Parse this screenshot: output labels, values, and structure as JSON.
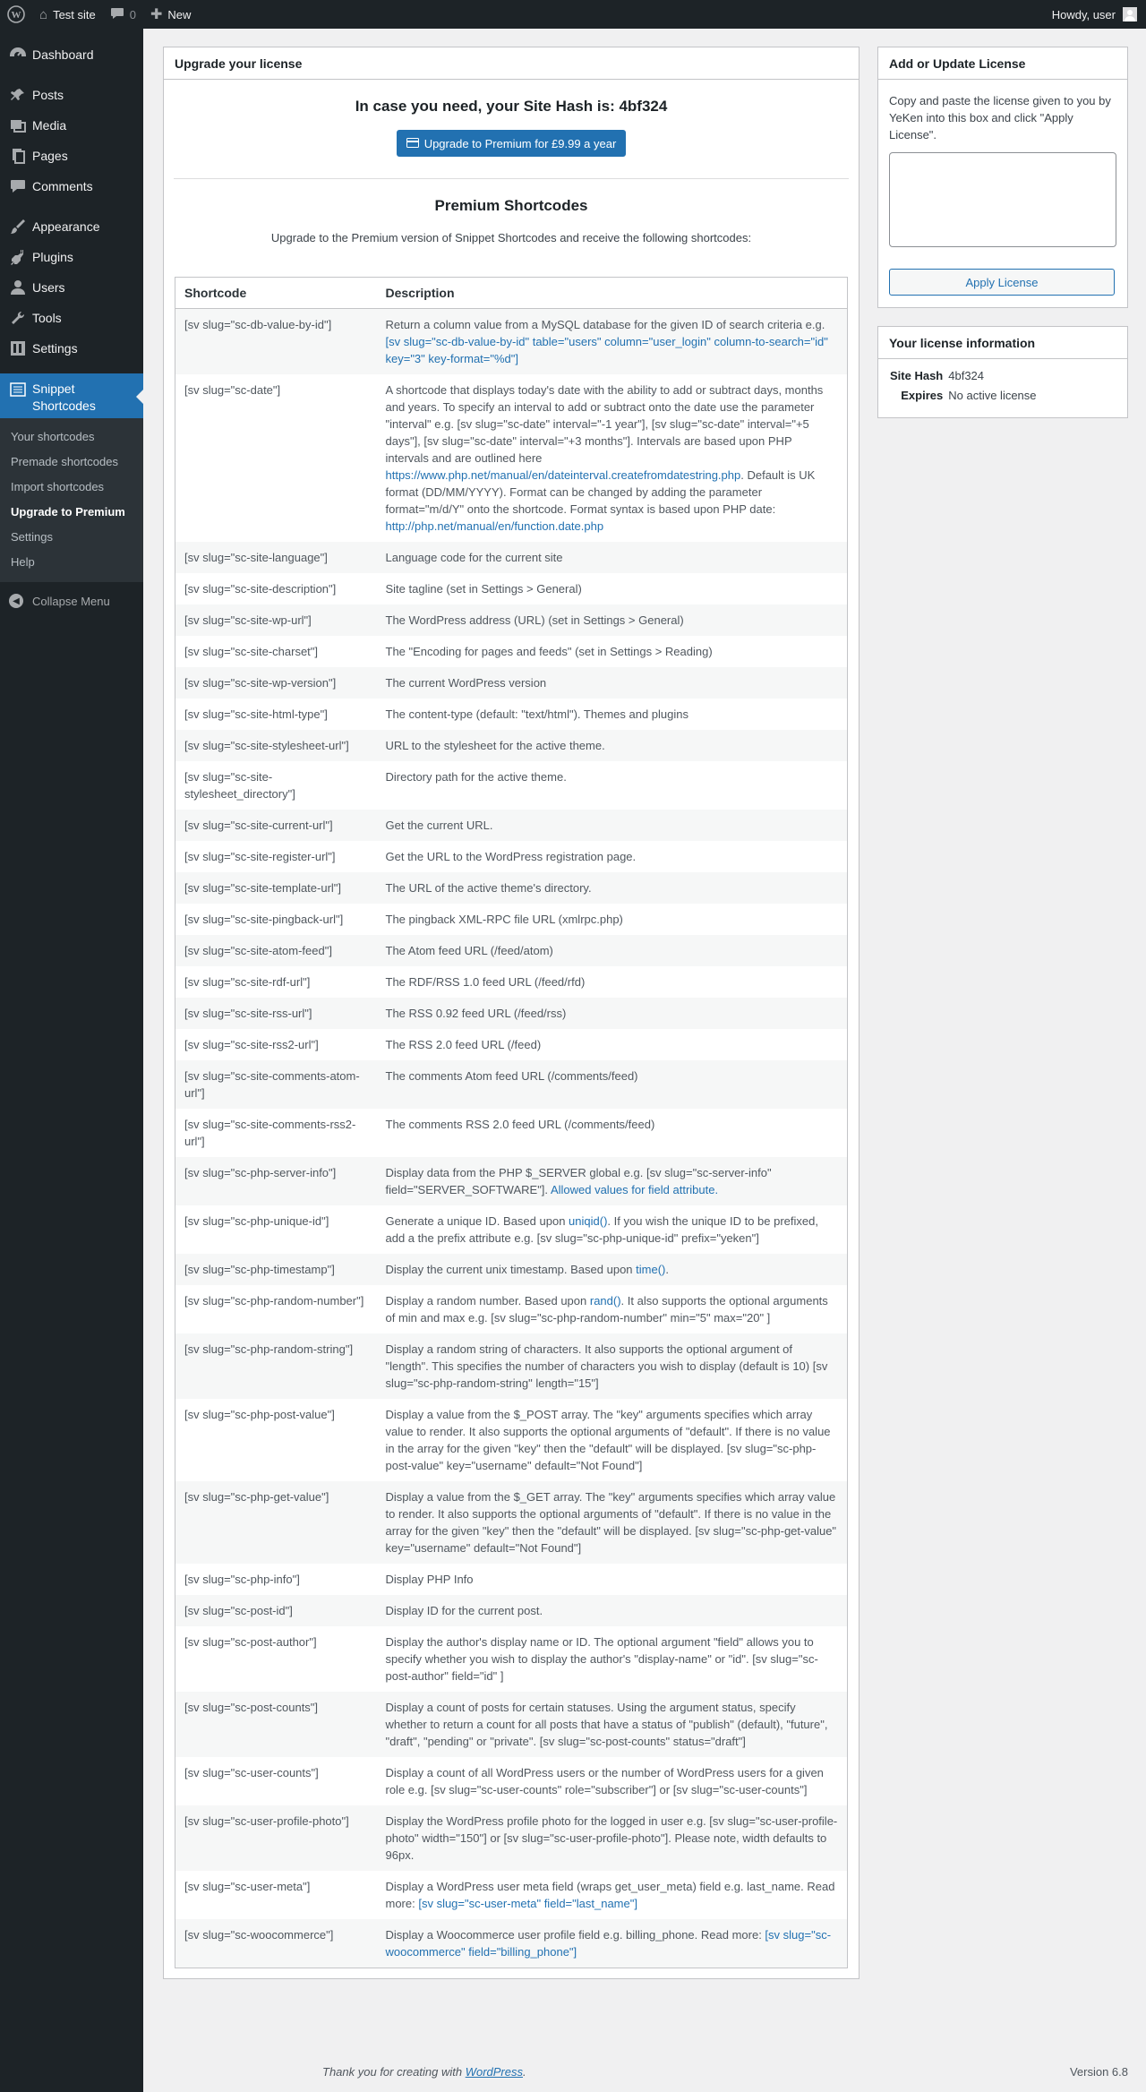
{
  "adminbar": {
    "site_name": "Test site",
    "comments_count": "0",
    "new_label": "New",
    "howdy": "Howdy, user"
  },
  "sidebar": {
    "items": [
      {
        "label": "Dashboard",
        "icon": "dashboard-icon"
      },
      {
        "label": "Posts",
        "icon": "pin-icon"
      },
      {
        "label": "Media",
        "icon": "media-icon"
      },
      {
        "label": "Pages",
        "icon": "pages-icon"
      },
      {
        "label": "Comments",
        "icon": "comment-icon"
      },
      {
        "label": "Appearance",
        "icon": "brush-icon"
      },
      {
        "label": "Plugins",
        "icon": "plug-icon"
      },
      {
        "label": "Users",
        "icon": "user-icon"
      },
      {
        "label": "Tools",
        "icon": "wrench-icon"
      },
      {
        "label": "Settings",
        "icon": "settings-icon"
      }
    ],
    "current_label_line1": "Snippet",
    "current_label_line2": "Shortcodes",
    "submenu": [
      "Your shortcodes",
      "Premade shortcodes",
      "Import shortcodes",
      "Upgrade to Premium",
      "Settings",
      "Help"
    ],
    "collapse": "Collapse Menu"
  },
  "main": {
    "box_title": "Upgrade your license",
    "site_hash_text": "In case you need, your Site Hash is: 4bf324",
    "upgrade_button": "Upgrade to Premium for £9.99 a year",
    "premium_title": "Premium Shortcodes",
    "premium_desc": "Upgrade to the Premium version of Snippet Shortcodes and receive the following shortcodes:",
    "table_headers": [
      "Shortcode",
      "Description"
    ],
    "rows": [
      {
        "code": "[sv slug=\"sc-db-value-by-id\"]",
        "desc": "Return a column value from a MySQL database for the given ID of search criteria e.g. ",
        "link": "[sv slug=\"sc-db-value-by-id\" table=\"users\" column=\"user_login\" column-to-search=\"id\" key=\"3\" key-format=\"%d\"]",
        "after": ""
      },
      {
        "code": "[sv slug=\"sc-date\"]",
        "desc": "A shortcode that displays today's date with the ability to add or subtract days, months and years. To specify an interval to add or subtract onto the date use the parameter \"interval\" e.g. [sv slug=\"sc-date\" interval=\"-1 year\"], [sv slug=\"sc-date\" interval=\"+5 days\"], [sv slug=\"sc-date\" interval=\"+3 months\"]. Intervals are based upon PHP intervals and are outlined here ",
        "link": "https://www.php.net/manual/en/dateinterval.createfromdatestring.php",
        "after": ". Default is UK format (DD/MM/YYYY). Format can be changed by adding the parameter format=\"m/d/Y\" onto the shortcode. Format syntax is based upon PHP date: ",
        "link2": "http://php.net/manual/en/function.date.php"
      },
      {
        "code": "[sv slug=\"sc-site-language\"]",
        "desc": "Language code for the current site"
      },
      {
        "code": "[sv slug=\"sc-site-description\"]",
        "desc": "Site tagline (set in Settings > General)"
      },
      {
        "code": "[sv slug=\"sc-site-wp-url\"]",
        "desc": "The WordPress address (URL) (set in Settings > General)"
      },
      {
        "code": "[sv slug=\"sc-site-charset\"]",
        "desc": "The \"Encoding for pages and feeds\" (set in Settings > Reading)"
      },
      {
        "code": "[sv slug=\"sc-site-wp-version\"]",
        "desc": "The current WordPress version"
      },
      {
        "code": "[sv slug=\"sc-site-html-type\"]",
        "desc": "The content-type (default: \"text/html\"). Themes and plugins"
      },
      {
        "code": "[sv slug=\"sc-site-stylesheet-url\"]",
        "desc": "URL to the stylesheet for the active theme."
      },
      {
        "code": "[sv slug=\"sc-site-stylesheet_directory\"]",
        "desc": "Directory path for the active theme."
      },
      {
        "code": "[sv slug=\"sc-site-current-url\"]",
        "desc": "Get the current URL."
      },
      {
        "code": "[sv slug=\"sc-site-register-url\"]",
        "desc": "Get the URL to the WordPress registration page."
      },
      {
        "code": "[sv slug=\"sc-site-template-url\"]",
        "desc": "The URL of the active theme's directory."
      },
      {
        "code": "[sv slug=\"sc-site-pingback-url\"]",
        "desc": "The pingback XML-RPC file URL (xmlrpc.php)"
      },
      {
        "code": "[sv slug=\"sc-site-atom-feed\"]",
        "desc": "The Atom feed URL (/feed/atom)"
      },
      {
        "code": "[sv slug=\"sc-site-rdf-url\"]",
        "desc": "The RDF/RSS 1.0 feed URL (/feed/rfd)"
      },
      {
        "code": "[sv slug=\"sc-site-rss-url\"]",
        "desc": "The RSS 0.92 feed URL (/feed/rss)"
      },
      {
        "code": "[sv slug=\"sc-site-rss2-url\"]",
        "desc": "The RSS 2.0 feed URL (/feed)"
      },
      {
        "code": "[sv slug=\"sc-site-comments-atom-url\"]",
        "desc": "The comments Atom feed URL (/comments/feed)"
      },
      {
        "code": "[sv slug=\"sc-site-comments-rss2-url\"]",
        "desc": "The comments RSS 2.0 feed URL (/comments/feed)"
      },
      {
        "code": "[sv slug=\"sc-php-server-info\"]",
        "desc": "Display data from the PHP $_SERVER global e.g. [sv slug=\"sc-server-info\" field=\"SERVER_SOFTWARE\"]. ",
        "link": "Allowed values for field attribute.",
        "after": ""
      },
      {
        "code": "[sv slug=\"sc-php-unique-id\"]",
        "desc": "Generate a unique ID. Based upon ",
        "link": "uniqid()",
        "after": ". If you wish the unique ID to be prefixed, add a the prefix attribute e.g. [sv slug=\"sc-php-unique-id\" prefix=\"yeken\"]"
      },
      {
        "code": "[sv slug=\"sc-php-timestamp\"]",
        "desc": "Display the current unix timestamp. Based upon ",
        "link": "time()",
        "after": "."
      },
      {
        "code": "[sv slug=\"sc-php-random-number\"]",
        "desc": "Display a random number. Based upon ",
        "link": "rand()",
        "after": ". It also supports the optional arguments of min and max e.g. [sv slug=\"sc-php-random-number\" min=\"5\" max=\"20\" ]"
      },
      {
        "code": "[sv slug=\"sc-php-random-string\"]",
        "desc": "Display a random string of characters. It also supports the optional argument of \"length\". This specifies the number of characters you wish to display (default is 10) [sv slug=\"sc-php-random-string\" length=\"15\"]"
      },
      {
        "code": "[sv slug=\"sc-php-post-value\"]",
        "desc": "Display a value from the $_POST array. The \"key\" arguments specifies which array value to render. It also supports the optional arguments of \"default\". If there is no value in the array for the given \"key\" then the \"default\" will be displayed. [sv slug=\"sc-php-post-value\" key=\"username\" default=\"Not Found\"]"
      },
      {
        "code": "[sv slug=\"sc-php-get-value\"]",
        "desc": "Display a value from the $_GET array. The \"key\" arguments specifies which array value to render. It also supports the optional arguments of \"default\". If there is no value in the array for the given \"key\" then the \"default\" will be displayed. [sv slug=\"sc-php-get-value\" key=\"username\" default=\"Not Found\"]"
      },
      {
        "code": "[sv slug=\"sc-php-info\"]",
        "desc": "Display PHP Info"
      },
      {
        "code": "[sv slug=\"sc-post-id\"]",
        "desc": "Display ID for the current post."
      },
      {
        "code": "[sv slug=\"sc-post-author\"]",
        "desc": "Display the author's display name or ID. The optional argument \"field\" allows you to specify whether you wish to display the author's \"display-name\" or \"id\". [sv slug=\"sc-post-author\" field=\"id\" ]"
      },
      {
        "code": "[sv slug=\"sc-post-counts\"]",
        "desc": "Display a count of posts for certain statuses. Using the argument status, specify whether to return a count for all posts that have a status of \"publish\" (default), \"future\", \"draft\", \"pending\" or \"private\". [sv slug=\"sc-post-counts\" status=\"draft\"]"
      },
      {
        "code": "[sv slug=\"sc-user-counts\"]",
        "desc": "Display a count of all WordPress users or the number of WordPress users for a given role e.g. [sv slug=\"sc-user-counts\" role=\"subscriber\"] or [sv slug=\"sc-user-counts\"]"
      },
      {
        "code": "[sv slug=\"sc-user-profile-photo\"]",
        "desc": "Display the WordPress profile photo for the logged in user e.g. [sv slug=\"sc-user-profile-photo\" width=\"150\"] or [sv slug=\"sc-user-profile-photo\"]. Please note, width defaults to 96px."
      },
      {
        "code": "[sv slug=\"sc-user-meta\"]",
        "desc": "Display a WordPress user meta field (wraps get_user_meta) field e.g. last_name. Read more: ",
        "link": "[sv slug=\"sc-user-meta\" field=\"last_name\"]",
        "after": ""
      },
      {
        "code": "[sv slug=\"sc-woocommerce\"]",
        "desc": "Display a Woocommerce user profile field e.g. billing_phone. Read more: ",
        "link": "[sv slug=\"sc-woocommerce\" field=\"billing_phone\"]",
        "after": ""
      }
    ]
  },
  "license": {
    "title": "Add or Update License",
    "instructions": "Copy and paste the license given to you by YeKen into this box and click \"Apply License\".",
    "textarea_value": "",
    "apply_button": "Apply License"
  },
  "info": {
    "title": "Your license information",
    "site_hash_label": "Site Hash",
    "site_hash_value": "4bf324",
    "expires_label": "Expires",
    "expires_value": "No active license"
  },
  "footer": {
    "thanks_prefix": "Thank you for creating with ",
    "thanks_link": "WordPress",
    "thanks_suffix": ".",
    "version": "Version 6.8"
  },
  "colors": {
    "accent": "#2271b1",
    "admin_dark": "#1d2327"
  }
}
